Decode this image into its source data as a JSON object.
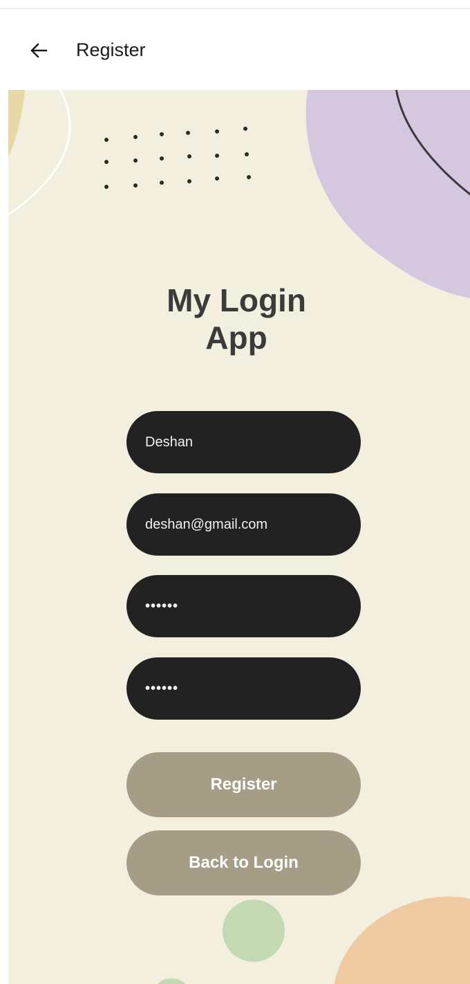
{
  "app_bar": {
    "title": "Register",
    "back_icon": "arrow-left-icon"
  },
  "content": {
    "app_title_line1": "My Login",
    "app_title_line2": "App"
  },
  "form": {
    "name_value": "Deshan",
    "email_value": "deshan@gmail.com",
    "password_value": "••••••",
    "confirm_password_value": "••••••"
  },
  "buttons": {
    "register_label": "Register",
    "back_to_login_label": "Back to Login"
  },
  "colors": {
    "background": "#f3efdf",
    "field": "#222222",
    "button": "#a59d85",
    "blob_purple": "#d6c7e1",
    "blob_green": "#c3d9b2",
    "blob_orange": "#efc9a0",
    "title_text": "#3b3b3b"
  }
}
